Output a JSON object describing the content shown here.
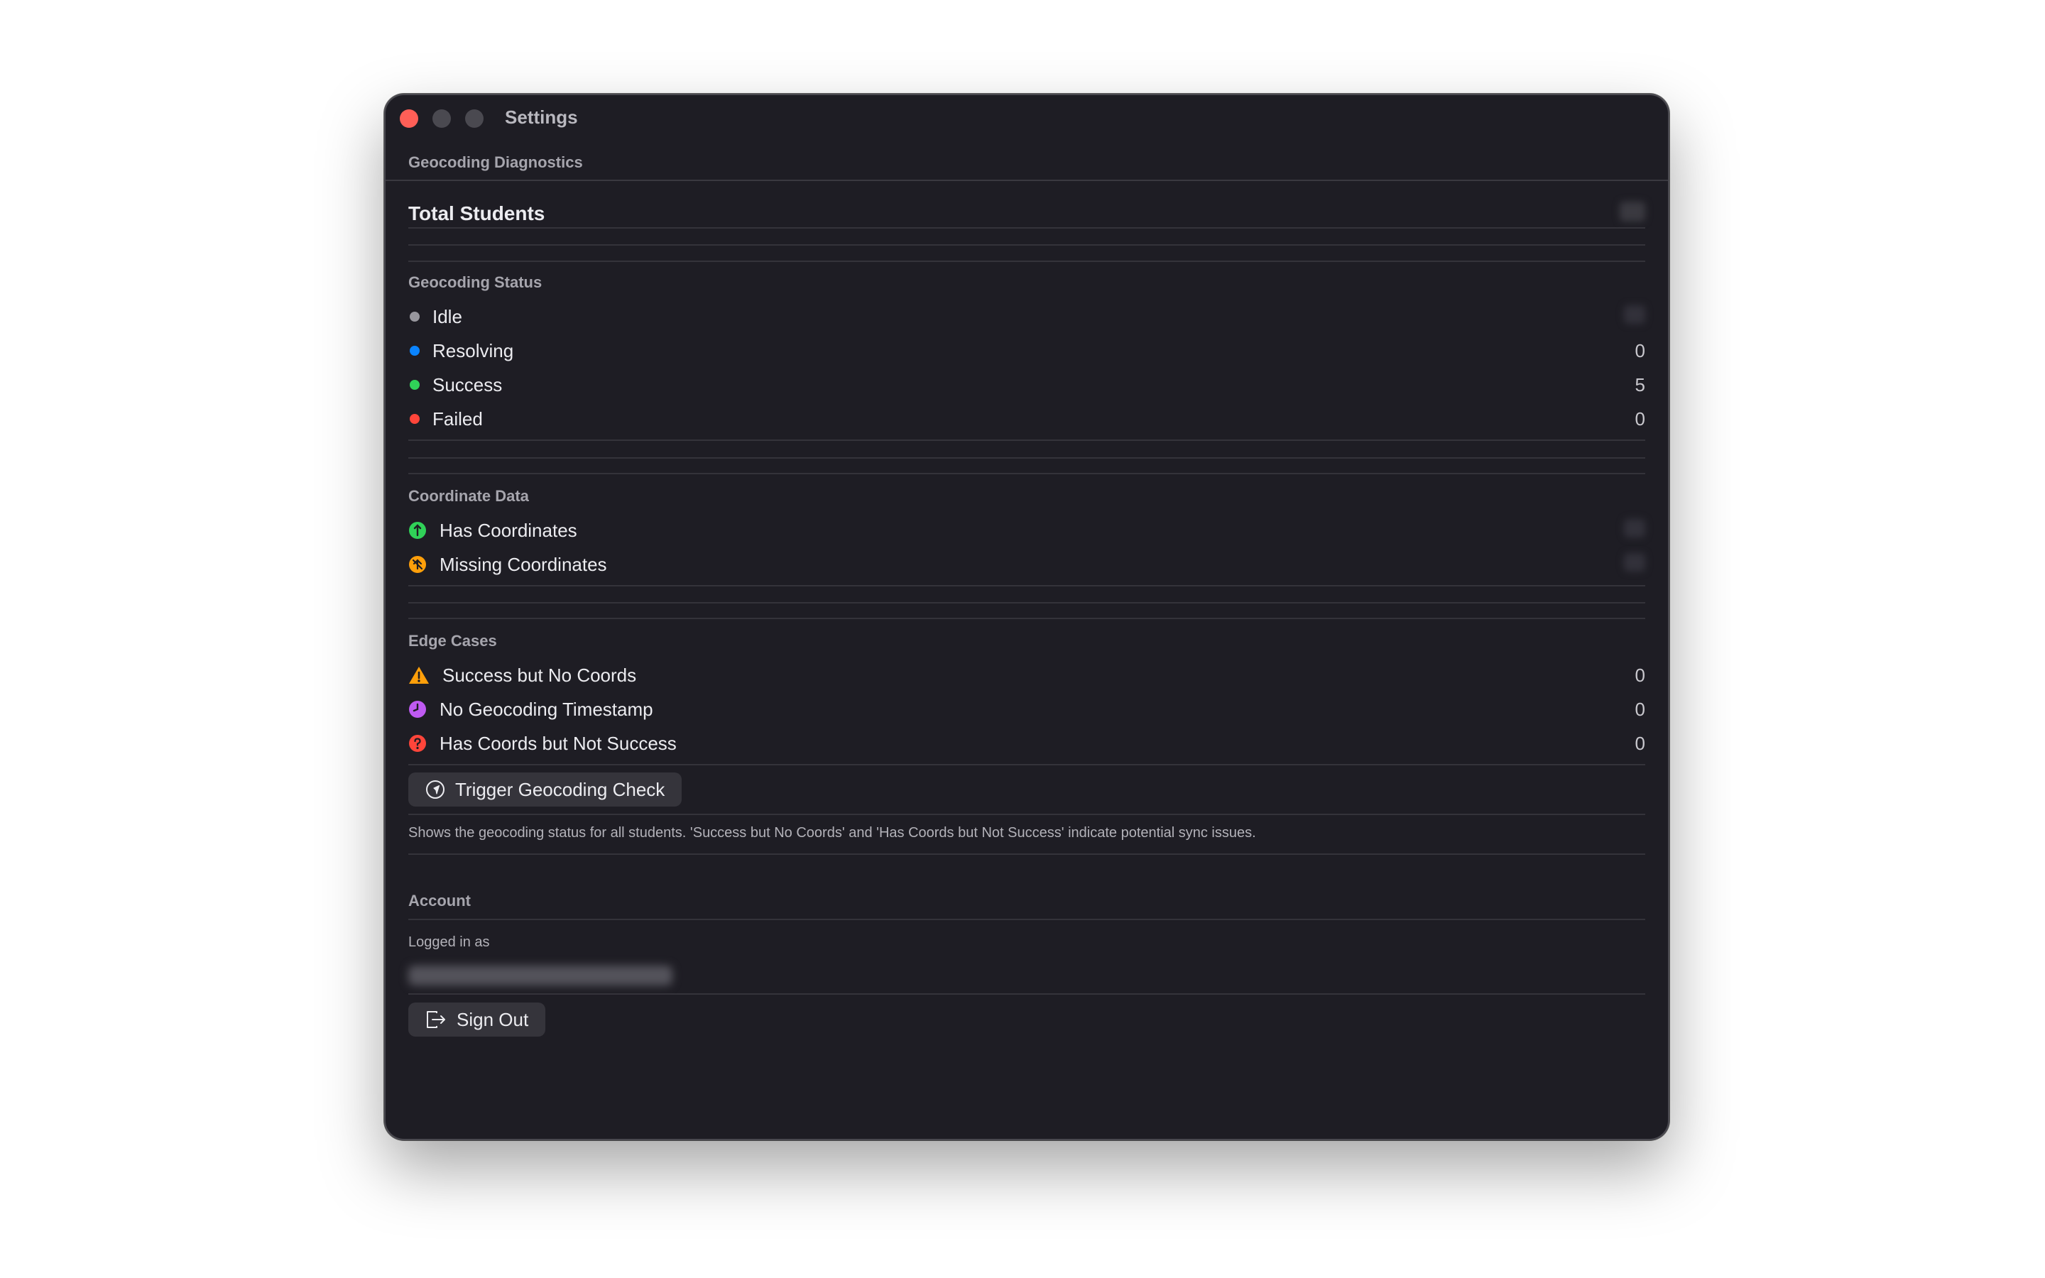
{
  "window": {
    "title": "Settings",
    "subtitle": "Geocoding Diagnostics"
  },
  "total": {
    "label": "Total Students"
  },
  "status_section": {
    "header": "Geocoding Status",
    "items": [
      {
        "label": "Idle",
        "value": "",
        "color": "#98979e"
      },
      {
        "label": "Resolving",
        "value": "0",
        "color": "#0a84ff"
      },
      {
        "label": "Success",
        "value": "5",
        "color": "#30d158"
      },
      {
        "label": "Failed",
        "value": "0",
        "color": "#ff453a"
      }
    ]
  },
  "coord_section": {
    "header": "Coordinate Data",
    "items": [
      {
        "label": "Has Coordinates",
        "icon": "location-pin-icon",
        "color": "#30d158"
      },
      {
        "label": "Missing Coordinates",
        "icon": "location-slash-icon",
        "color": "#ff9f0a"
      }
    ]
  },
  "edge_section": {
    "header": "Edge Cases",
    "items": [
      {
        "label": "Success but No Coords",
        "value": "0",
        "icon": "warning-triangle-icon",
        "color": "#ff9f0a"
      },
      {
        "label": "No Geocoding Timestamp",
        "value": "0",
        "icon": "clock-icon",
        "color": "#bf5af2"
      },
      {
        "label": "Has Coords but Not Success",
        "value": "0",
        "icon": "question-circle-icon",
        "color": "#ff453a"
      }
    ],
    "trigger_button": "Trigger Geocoding Check",
    "caption": "Shows the geocoding status for all students. 'Success but No Coords' and 'Has Coords but Not Success' indicate potential sync issues."
  },
  "account": {
    "header": "Account",
    "logged_in_label": "Logged in as",
    "sign_out_button": "Sign Out"
  }
}
